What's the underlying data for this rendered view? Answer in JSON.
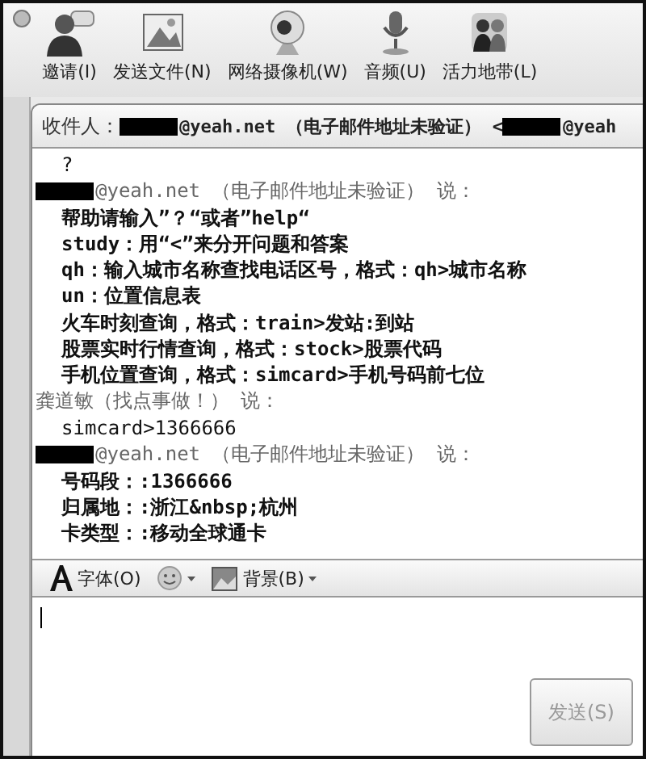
{
  "toolbar": {
    "items": [
      {
        "label": "邀请(I)"
      },
      {
        "label": "发送文件(N)"
      },
      {
        "label": "网络摄像机(W)"
      },
      {
        "label": "音频(U)"
      },
      {
        "label": "活力地带(L)"
      }
    ]
  },
  "recipient": {
    "label": "收件人：",
    "entries": [
      {
        "redacted": true,
        "text": "@yeah.net （电子邮件地址未验证） <"
      },
      {
        "redacted": true,
        "text": "@yeah"
      }
    ]
  },
  "messages": [
    {
      "lines": [
        {
          "text": "?",
          "bold": false
        }
      ]
    },
    {
      "sender": {
        "redacted": true,
        "text": "@yeah.net （电子邮件地址未验证） 说："
      },
      "lines": [
        {
          "text": "帮助请输入”？“或者”help“",
          "bold": true
        },
        {
          "text": "study：用“<”来分开问题和答案",
          "bold": true
        },
        {
          "text": "qh：输入城市名称查找电话区号，格式：qh>城市名称",
          "bold": true
        },
        {
          "text": "un：位置信息表",
          "bold": true
        },
        {
          "text": "火车时刻查询，格式：train>发站:到站",
          "bold": true
        },
        {
          "text": "股票实时行情查询，格式：stock>股票代码",
          "bold": true
        },
        {
          "text": "手机位置查询，格式：simcard>手机号码前七位",
          "bold": true
        }
      ]
    },
    {
      "sender": {
        "redacted": false,
        "text": "龚道敏（找点事做！） 说："
      },
      "lines": [
        {
          "text": "simcard>1366666",
          "bold": false
        }
      ]
    },
    {
      "sender": {
        "redacted": true,
        "text": "@yeah.net （电子邮件地址未验证） 说："
      },
      "lines": [
        {
          "text": "号码段：:1366666",
          "bold": true
        },
        {
          "text": "归属地：:浙江&nbsp;杭州",
          "bold": true
        },
        {
          "text": "卡类型：:移动全球通卡",
          "bold": true
        }
      ]
    }
  ],
  "compose": {
    "tools": [
      {
        "kind": "font",
        "label": "字体(O)"
      },
      {
        "kind": "emoticon"
      },
      {
        "kind": "background",
        "label": "背景(B)"
      }
    ],
    "send_button": "发送(S)"
  }
}
